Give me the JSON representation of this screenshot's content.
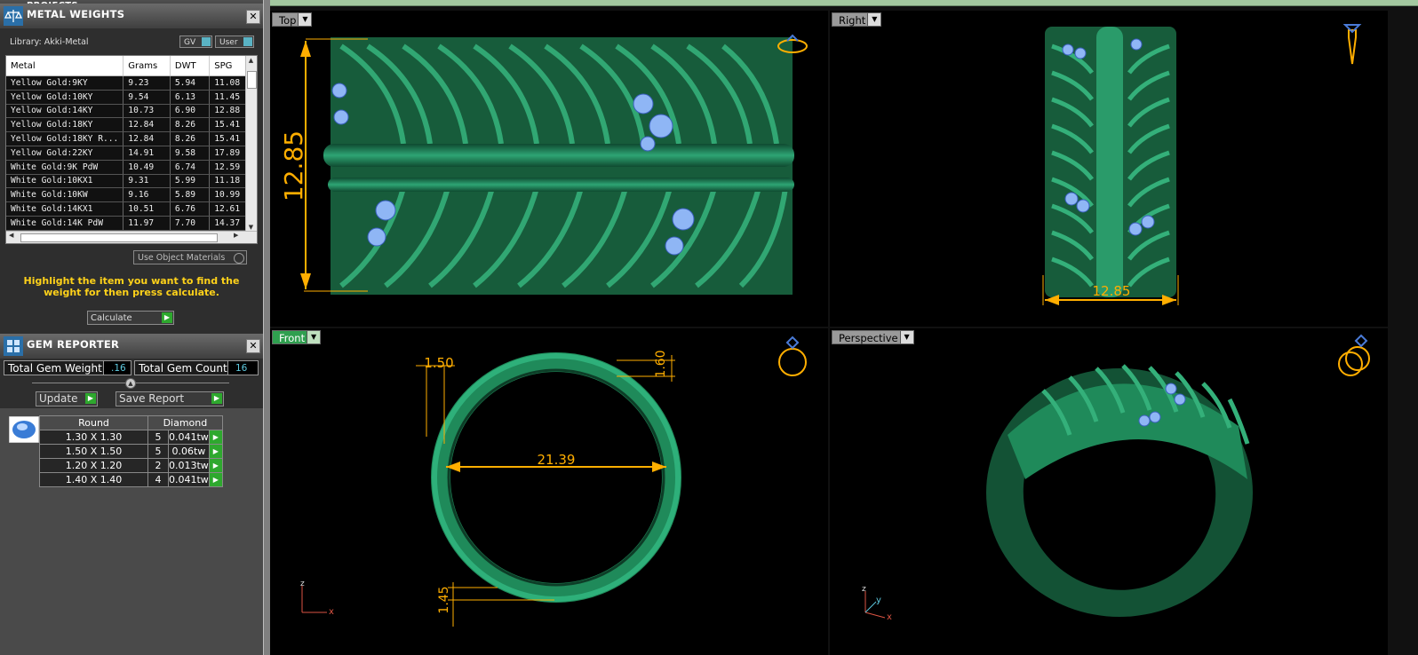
{
  "app": {
    "top_panel_title": "PROJECTS"
  },
  "metal_weights": {
    "title": "METAL WEIGHTS",
    "library": "Library: Akki-Metal",
    "toggle_gv": "GV",
    "toggle_user": "User",
    "columns": [
      "Metal",
      "Grams",
      "DWT",
      "SPG"
    ],
    "rows": [
      [
        "Yellow Gold:9KY",
        "9.23",
        "5.94",
        "11.08"
      ],
      [
        "Yellow Gold:10KY",
        "9.54",
        "6.13",
        "11.45"
      ],
      [
        "Yellow Gold:14KY",
        "10.73",
        "6.90",
        "12.88"
      ],
      [
        "Yellow Gold:18KY",
        "12.84",
        "8.26",
        "15.41"
      ],
      [
        "Yellow Gold:18KY R...",
        "12.84",
        "8.26",
        "15.41"
      ],
      [
        "Yellow Gold:22KY",
        "14.91",
        "9.58",
        "17.89"
      ],
      [
        "White Gold:9K PdW",
        "10.49",
        "6.74",
        "12.59"
      ],
      [
        "White Gold:10KX1",
        "9.31",
        "5.99",
        "11.18"
      ],
      [
        "White Gold:10KW",
        "9.16",
        "5.89",
        "10.99"
      ],
      [
        "White Gold:14KX1",
        "10.51",
        "6.76",
        "12.61"
      ],
      [
        "White Gold:14K PdW",
        "11.97",
        "7.70",
        "14.37"
      ]
    ],
    "use_object_materials": "Use Object Materials",
    "hint": "Highlight the item you want to find the weight for then press calculate.",
    "calculate": "Calculate"
  },
  "gem_reporter": {
    "title": "GEM REPORTER",
    "total_weight_label": "Total Gem Weight",
    "total_weight_value": ".16",
    "total_count_label": "Total Gem Count",
    "total_count_value": "16",
    "update": "Update",
    "save_report": "Save Report",
    "header_cut": "Round",
    "header_type": "Diamond",
    "gems": [
      {
        "size": "1.30 X 1.30",
        "count": "5",
        "weight": "0.041tw"
      },
      {
        "size": "1.50 X 1.50",
        "count": "5",
        "weight": "0.06tw"
      },
      {
        "size": "1.20 X 1.20",
        "count": "2",
        "weight": "0.013tw"
      },
      {
        "size": "1.40 X 1.40",
        "count": "4",
        "weight": "0.041tw"
      }
    ]
  },
  "viewports": {
    "top": {
      "label": "Top",
      "dim": "12.85"
    },
    "right": {
      "label": "Right",
      "dim": "12.85"
    },
    "front": {
      "label": "Front",
      "dim_top": "1.50",
      "dim_right": "1.60",
      "dim_diameter": "21.39",
      "dim_bottom": "1.45",
      "axis_z": "z",
      "axis_x": "x"
    },
    "perspective": {
      "label": "Perspective",
      "axis_z": "z",
      "axis_y": "y",
      "axis_x": "x"
    }
  },
  "colors": {
    "ring_green": "#1f8a5a",
    "gem_blue": "#8fb6f5",
    "dimension": "#ffae00"
  }
}
